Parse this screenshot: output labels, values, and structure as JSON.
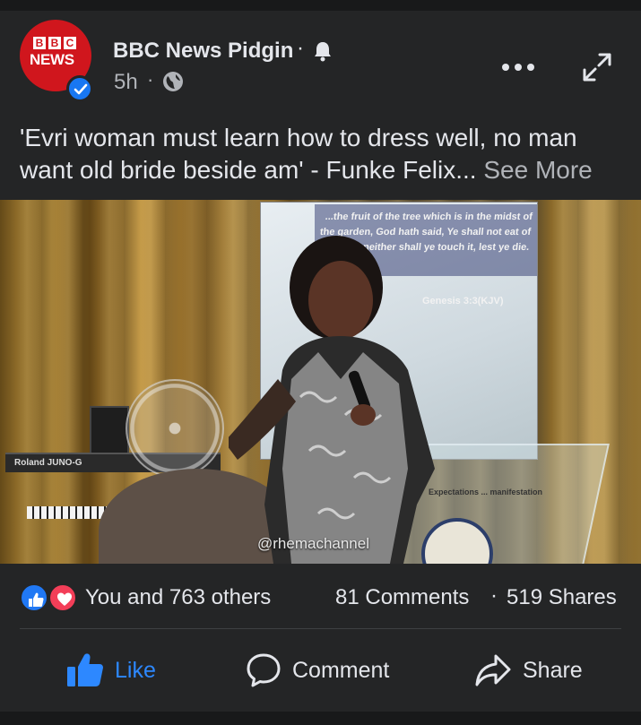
{
  "post": {
    "page_name": "BBC News Pidgin",
    "name_separator": "·",
    "time": "5h",
    "meta_separator": "·",
    "avatar": {
      "blocks": [
        "B",
        "B",
        "C"
      ],
      "word": "NEWS",
      "bg_color": "#d0161d",
      "verified_badge_color": "#1877f2"
    },
    "text": "'Evri woman must learn how to dress well, no man want old bride beside am' - Funke Felix...",
    "see_more": "See More",
    "icons": [
      "bell-icon",
      "globe-icon",
      "more-dots-icon",
      "expand-icon"
    ]
  },
  "video": {
    "screen_verse": "...the fruit of the tree which is in the midst of the garden, God hath said, Ye shall not eat of it, neither shall ye touch it, lest ye die.",
    "screen_reference": "Genesis 3:3(KJV)",
    "keyboard_label": "Roland JUNO-G",
    "lectern_text": "Expectations ... manifestation",
    "watermark": "@rhemachannel"
  },
  "stats": {
    "reaction_types": [
      "like",
      "love"
    ],
    "reactions_text": "You and 763 others",
    "comments": "81 Comments",
    "separator": "·",
    "shares": "519 Shares"
  },
  "actions": {
    "like_label": "Like",
    "comment_label": "Comment",
    "share_label": "Share",
    "like_color": "#2d88ff"
  },
  "theme": {
    "card_bg": "#242526",
    "page_bg": "#18191a",
    "text_primary": "#e4e6eb",
    "text_secondary": "#b0b3b8"
  }
}
